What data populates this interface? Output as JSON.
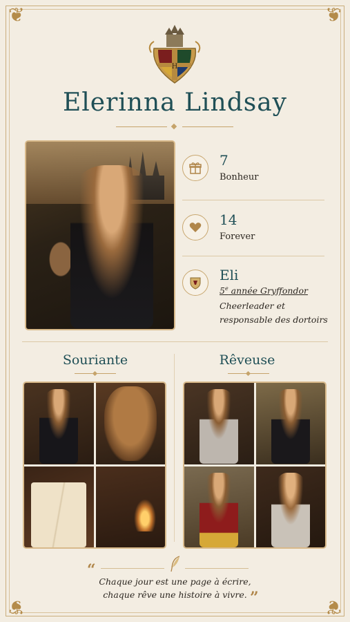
{
  "profile": {
    "name": "Elerinna Lindsay"
  },
  "stats": [
    {
      "value": "7",
      "label": "Bonheur",
      "icon": "gift-icon"
    },
    {
      "value": "14",
      "label": "Forever",
      "icon": "heart-icon"
    },
    {
      "value": "Eli",
      "icon": "house-crest-icon",
      "line1_ordinal": "5",
      "line1_sup": "e",
      "line1_rest": " année Gryffondor",
      "line2": "Cheerleader et responsable des dortoirs"
    }
  ],
  "sections": [
    {
      "title": "Souriante"
    },
    {
      "title": "Rêveuse"
    }
  ],
  "quote": {
    "line1": "Chaque jour est une page à écrire,",
    "line2": "chaque rêve une histoire à vivre."
  },
  "colors": {
    "accent_gold": "#c5a36a",
    "title_teal": "#1f4f56",
    "background": "#f3ede2"
  }
}
